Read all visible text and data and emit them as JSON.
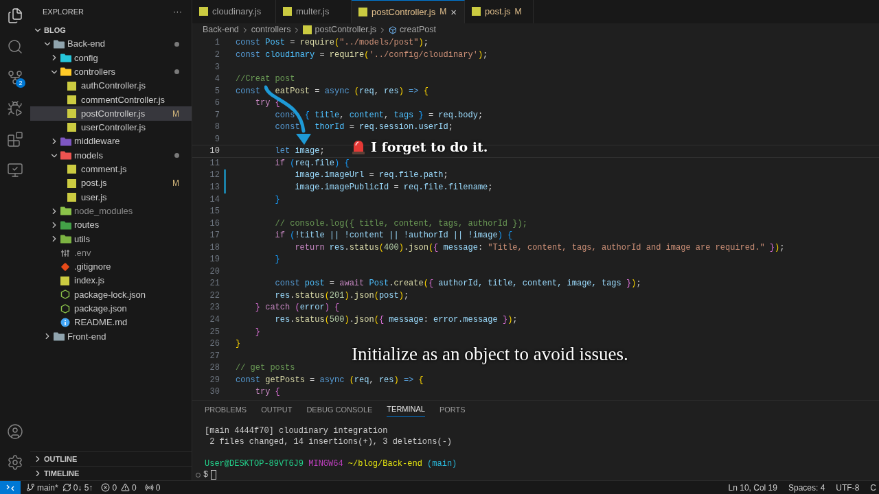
{
  "activity_bar": {
    "items": [
      {
        "kind": "explorer",
        "selected": true
      },
      {
        "kind": "search",
        "selected": false
      },
      {
        "kind": "source-control",
        "selected": false,
        "badge": "2"
      },
      {
        "kind": "run-debug",
        "selected": false
      },
      {
        "kind": "extensions",
        "selected": false
      },
      {
        "kind": "remote",
        "selected": false
      }
    ],
    "bottom": [
      {
        "kind": "account"
      },
      {
        "kind": "settings"
      }
    ]
  },
  "sidebar": {
    "title": "EXPLORER",
    "more": "···",
    "workspace": {
      "label": "BLOG",
      "expanded": true
    },
    "tree": [
      {
        "kind": "folder",
        "label": "Back-end",
        "color": "#90a4ae",
        "expanded": true,
        "dot": true,
        "selected": false,
        "dimmed": false,
        "children": [
          {
            "kind": "folder",
            "label": "config",
            "color": "#26c6da",
            "expanded": false,
            "dot": false,
            "selected": false,
            "dimmed": false
          },
          {
            "kind": "folder",
            "label": "controllers",
            "color": "#ffca28",
            "expanded": true,
            "dot": true,
            "selected": false,
            "dimmed": false,
            "children": [
              {
                "kind": "js",
                "label": "authController.js",
                "dot": false,
                "selected": false,
                "dimmed": false
              },
              {
                "kind": "js",
                "label": "commentController.js",
                "dot": false,
                "selected": false,
                "dimmed": false
              },
              {
                "kind": "js",
                "label": "postController.js",
                "badge": "M",
                "dot": false,
                "selected": true,
                "dimmed": false
              },
              {
                "kind": "js",
                "label": "userController.js",
                "dot": false,
                "selected": false,
                "dimmed": false
              }
            ]
          },
          {
            "kind": "folder",
            "label": "middleware",
            "color": "#7e57c2",
            "expanded": false,
            "dot": false,
            "selected": false,
            "dimmed": false
          },
          {
            "kind": "folder",
            "label": "models",
            "color": "#ef5350",
            "expanded": true,
            "dot": true,
            "selected": false,
            "dimmed": false,
            "children": [
              {
                "kind": "js",
                "label": "comment.js",
                "dot": false,
                "selected": false,
                "dimmed": false
              },
              {
                "kind": "js",
                "label": "post.js",
                "badge": "M",
                "dot": false,
                "selected": false,
                "dimmed": false
              },
              {
                "kind": "js",
                "label": "user.js",
                "dot": false,
                "selected": false,
                "dimmed": false
              }
            ]
          },
          {
            "kind": "folder",
            "label": "node_modules",
            "color": "#8bc34a",
            "expanded": false,
            "dot": false,
            "selected": false,
            "dimmed": true
          },
          {
            "kind": "folder",
            "label": "routes",
            "color": "#43a047",
            "expanded": false,
            "dot": false,
            "selected": false,
            "dimmed": false
          },
          {
            "kind": "folder",
            "label": "utils",
            "color": "#7cb342",
            "expanded": false,
            "dot": false,
            "selected": false,
            "dimmed": false
          },
          {
            "kind": "env",
            "label": ".env",
            "dot": false,
            "selected": false,
            "dimmed": true
          },
          {
            "kind": "git",
            "label": ".gitignore",
            "dot": false,
            "selected": false,
            "dimmed": false
          },
          {
            "kind": "js",
            "label": "index.js",
            "dot": false,
            "selected": false,
            "dimmed": false
          },
          {
            "kind": "npm",
            "label": "package-lock.json",
            "dot": false,
            "selected": false,
            "dimmed": false
          },
          {
            "kind": "npm",
            "label": "package.json",
            "dot": false,
            "selected": false,
            "dimmed": false
          },
          {
            "kind": "info",
            "label": "README.md",
            "dot": false,
            "selected": false,
            "dimmed": false
          }
        ]
      },
      {
        "kind": "folder",
        "label": "Front-end",
        "color": "#90a4ae",
        "expanded": false,
        "dot": false,
        "selected": false,
        "dimmed": false
      }
    ],
    "sections": [
      {
        "label": "OUTLINE",
        "expanded": false
      },
      {
        "label": "TIMELINE",
        "expanded": false
      }
    ]
  },
  "tabs": [
    {
      "label": "cloudinary.js",
      "selected": false
    },
    {
      "label": "multer.js",
      "selected": false
    },
    {
      "label": "postController.js",
      "badge": "M",
      "close": "×",
      "selected": true
    },
    {
      "label": "post.js",
      "badge": "M",
      "selected": false
    }
  ],
  "breadcrumb": [
    {
      "kind": "folder",
      "label": "Back-end"
    },
    {
      "kind": "folder",
      "label": "controllers"
    },
    {
      "kind": "file",
      "label": "postController.js"
    },
    {
      "kind": "symbol",
      "label": "creatPost"
    }
  ],
  "code": [
    {
      "num": "1",
      "current": false,
      "changed": false,
      "tokens": [
        {
          "text": "const ",
          "kind": "keyword"
        },
        {
          "text": "Post",
          "kind": "constant"
        },
        {
          "text": " = ",
          "kind": "punctuation"
        },
        {
          "text": "require",
          "kind": "function"
        },
        {
          "text": "(",
          "kind": "bracket1"
        },
        {
          "text": "\"../models/post\"",
          "kind": "string"
        },
        {
          "text": ")",
          "kind": "bracket1"
        },
        {
          "text": ";",
          "kind": "punctuation"
        }
      ]
    },
    {
      "num": "2",
      "current": false,
      "changed": false,
      "tokens": [
        {
          "text": "const ",
          "kind": "keyword"
        },
        {
          "text": "cloudinary",
          "kind": "constant"
        },
        {
          "text": " = ",
          "kind": "punctuation"
        },
        {
          "text": "require",
          "kind": "function"
        },
        {
          "text": "(",
          "kind": "bracket1"
        },
        {
          "text": "'../config/cloudinary'",
          "kind": "string"
        },
        {
          "text": ")",
          "kind": "bracket1"
        },
        {
          "text": ";",
          "kind": "punctuation"
        }
      ]
    },
    {
      "num": "3",
      "current": false,
      "changed": false
    },
    {
      "num": "4",
      "current": false,
      "changed": false,
      "tokens": [
        {
          "text": "//Creat post",
          "kind": "comment"
        }
      ]
    },
    {
      "num": "5",
      "current": false,
      "changed": false,
      "tokens": [
        {
          "text": "const",
          "kind": "keyword"
        },
        {
          "text": "   eatPost",
          "kind": "function"
        },
        {
          "text": " = ",
          "kind": "punctuation"
        },
        {
          "text": "async ",
          "kind": "keyword"
        },
        {
          "text": "(",
          "kind": "bracket1"
        },
        {
          "text": "req",
          "kind": "variable"
        },
        {
          "text": ", ",
          "kind": "punctuation"
        },
        {
          "text": "res",
          "kind": "variable"
        },
        {
          "text": ")",
          "kind": "bracket1"
        },
        {
          "text": " => ",
          "kind": "keyword"
        },
        {
          "text": "{",
          "kind": "bracket1"
        }
      ]
    },
    {
      "num": "6",
      "current": false,
      "changed": false,
      "tokens": [
        {
          "text": "    try ",
          "kind": "control"
        },
        {
          "text": "{",
          "kind": "bracket2"
        }
      ]
    },
    {
      "num": "7",
      "current": false,
      "changed": false,
      "tokens": [
        {
          "text": "        cons",
          "kind": "keyword"
        },
        {
          "text": "  { ",
          "kind": "bracket3"
        },
        {
          "text": "title",
          "kind": "constant"
        },
        {
          "text": ", ",
          "kind": "punctuation"
        },
        {
          "text": "content",
          "kind": "constant"
        },
        {
          "text": ", ",
          "kind": "punctuation"
        },
        {
          "text": "tags",
          "kind": "constant"
        },
        {
          "text": " }",
          "kind": "bracket3"
        },
        {
          "text": " = ",
          "kind": "punctuation"
        },
        {
          "text": "req.body",
          "kind": "variable"
        },
        {
          "text": ";",
          "kind": "punctuation"
        }
      ]
    },
    {
      "num": "8",
      "current": false,
      "changed": false,
      "tokens": [
        {
          "text": "        const",
          "kind": "keyword"
        },
        {
          "text": "   thorId",
          "kind": "constant"
        },
        {
          "text": " = ",
          "kind": "punctuation"
        },
        {
          "text": "req.session.userId",
          "kind": "variable"
        },
        {
          "text": ";",
          "kind": "punctuation"
        }
      ]
    },
    {
      "num": "9",
      "current": false,
      "changed": false
    },
    {
      "num": "10",
      "current": true,
      "changed": false,
      "tokens": [
        {
          "text": "        let ",
          "kind": "keyword"
        },
        {
          "text": "image",
          "kind": "variable"
        },
        {
          "text": ";",
          "kind": "punctuation"
        }
      ]
    },
    {
      "num": "11",
      "current": false,
      "changed": false,
      "tokens": [
        {
          "text": "        if ",
          "kind": "control"
        },
        {
          "text": "(",
          "kind": "bracket3"
        },
        {
          "text": "req.file",
          "kind": "variable"
        },
        {
          "text": ") ",
          "kind": "bracket3"
        },
        {
          "text": "{",
          "kind": "bracket3"
        }
      ]
    },
    {
      "num": "12",
      "current": false,
      "changed": true,
      "tokens": [
        {
          "text": "            image.imageUrl",
          "kind": "variable"
        },
        {
          "text": " = ",
          "kind": "punctuation"
        },
        {
          "text": "req.file.path",
          "kind": "variable"
        },
        {
          "text": ";",
          "kind": "punctuation"
        }
      ]
    },
    {
      "num": "13",
      "current": false,
      "changed": true,
      "tokens": [
        {
          "text": "            image.imagePublicId",
          "kind": "variable"
        },
        {
          "text": " = ",
          "kind": "punctuation"
        },
        {
          "text": "req.file.filename",
          "kind": "variable"
        },
        {
          "text": ";",
          "kind": "punctuation"
        }
      ]
    },
    {
      "num": "14",
      "current": false,
      "changed": false,
      "tokens": [
        {
          "text": "        }",
          "kind": "bracket3"
        }
      ]
    },
    {
      "num": "15",
      "current": false,
      "changed": false
    },
    {
      "num": "16",
      "current": false,
      "changed": false,
      "tokens": [
        {
          "text": "        // console.log({ title, content, tags, authorId });",
          "kind": "comment"
        }
      ]
    },
    {
      "num": "17",
      "current": false,
      "changed": false,
      "tokens": [
        {
          "text": "        if ",
          "kind": "control"
        },
        {
          "text": "(",
          "kind": "bracket3"
        },
        {
          "text": "!title || !content || !authorId || !image",
          "kind": "variable"
        },
        {
          "text": ") ",
          "kind": "bracket3"
        },
        {
          "text": "{",
          "kind": "bracket3"
        }
      ]
    },
    {
      "num": "18",
      "current": false,
      "changed": false,
      "tokens": [
        {
          "text": "            return ",
          "kind": "control"
        },
        {
          "text": "res",
          "kind": "variable"
        },
        {
          "text": ".",
          "kind": "punctuation"
        },
        {
          "text": "status",
          "kind": "function"
        },
        {
          "text": "(",
          "kind": "bracket1"
        },
        {
          "text": "400",
          "kind": "number"
        },
        {
          "text": ")",
          "kind": "bracket1"
        },
        {
          "text": ".",
          "kind": "punctuation"
        },
        {
          "text": "json",
          "kind": "function"
        },
        {
          "text": "(",
          "kind": "bracket1"
        },
        {
          "text": "{ ",
          "kind": "bracket2"
        },
        {
          "text": "message",
          "kind": "variable"
        },
        {
          "text": ": ",
          "kind": "punctuation"
        },
        {
          "text": "\"Title, content, tags, authorId and image are required.\"",
          "kind": "string"
        },
        {
          "text": " }",
          "kind": "bracket2"
        },
        {
          "text": ")",
          "kind": "bracket1"
        },
        {
          "text": ";",
          "kind": "punctuation"
        }
      ]
    },
    {
      "num": "19",
      "current": false,
      "changed": false,
      "tokens": [
        {
          "text": "        }",
          "kind": "bracket3"
        }
      ]
    },
    {
      "num": "20",
      "current": false,
      "changed": false
    },
    {
      "num": "21",
      "current": false,
      "changed": false,
      "tokens": [
        {
          "text": "        const ",
          "kind": "keyword"
        },
        {
          "text": "post",
          "kind": "constant"
        },
        {
          "text": " = ",
          "kind": "punctuation"
        },
        {
          "text": "await ",
          "kind": "control"
        },
        {
          "text": "Post",
          "kind": "constant"
        },
        {
          "text": ".",
          "kind": "punctuation"
        },
        {
          "text": "create",
          "kind": "function"
        },
        {
          "text": "(",
          "kind": "bracket1"
        },
        {
          "text": "{ ",
          "kind": "bracket2"
        },
        {
          "text": "authorId, title, content, image, tags",
          "kind": "variable"
        },
        {
          "text": " }",
          "kind": "bracket2"
        },
        {
          "text": ")",
          "kind": "bracket1"
        },
        {
          "text": ";",
          "kind": "punctuation"
        }
      ]
    },
    {
      "num": "22",
      "current": false,
      "changed": false,
      "tokens": [
        {
          "text": "        res",
          "kind": "variable"
        },
        {
          "text": ".",
          "kind": "punctuation"
        },
        {
          "text": "status",
          "kind": "function"
        },
        {
          "text": "(",
          "kind": "bracket1"
        },
        {
          "text": "201",
          "kind": "number"
        },
        {
          "text": ")",
          "kind": "bracket1"
        },
        {
          "text": ".",
          "kind": "punctuation"
        },
        {
          "text": "json",
          "kind": "function"
        },
        {
          "text": "(",
          "kind": "bracket1"
        },
        {
          "text": "post",
          "kind": "variable"
        },
        {
          "text": ")",
          "kind": "bracket1"
        },
        {
          "text": ";",
          "kind": "punctuation"
        }
      ]
    },
    {
      "num": "23",
      "current": false,
      "changed": false,
      "tokens": [
        {
          "text": "    }",
          "kind": "bracket2"
        },
        {
          "text": " catch ",
          "kind": "control"
        },
        {
          "text": "(",
          "kind": "bracket2"
        },
        {
          "text": "error",
          "kind": "variable"
        },
        {
          "text": ") ",
          "kind": "bracket2"
        },
        {
          "text": "{",
          "kind": "bracket2"
        }
      ]
    },
    {
      "num": "24",
      "current": false,
      "changed": false,
      "tokens": [
        {
          "text": "        res",
          "kind": "variable"
        },
        {
          "text": ".",
          "kind": "punctuation"
        },
        {
          "text": "status",
          "kind": "function"
        },
        {
          "text": "(",
          "kind": "bracket1"
        },
        {
          "text": "500",
          "kind": "number"
        },
        {
          "text": ")",
          "kind": "bracket1"
        },
        {
          "text": ".",
          "kind": "punctuation"
        },
        {
          "text": "json",
          "kind": "function"
        },
        {
          "text": "(",
          "kind": "bracket1"
        },
        {
          "text": "{ ",
          "kind": "bracket2"
        },
        {
          "text": "message",
          "kind": "variable"
        },
        {
          "text": ": ",
          "kind": "punctuation"
        },
        {
          "text": "error.message",
          "kind": "variable"
        },
        {
          "text": " }",
          "kind": "bracket2"
        },
        {
          "text": ")",
          "kind": "bracket1"
        },
        {
          "text": ";",
          "kind": "punctuation"
        }
      ]
    },
    {
      "num": "25",
      "current": false,
      "changed": false,
      "tokens": [
        {
          "text": "    }",
          "kind": "bracket2"
        }
      ]
    },
    {
      "num": "26",
      "current": false,
      "changed": false,
      "tokens": [
        {
          "text": "}",
          "kind": "bracket1"
        }
      ]
    },
    {
      "num": "27",
      "current": false,
      "changed": false
    },
    {
      "num": "28",
      "current": false,
      "changed": false,
      "tokens": [
        {
          "text": "// get posts",
          "kind": "comment"
        }
      ]
    },
    {
      "num": "29",
      "current": false,
      "changed": false,
      "tokens": [
        {
          "text": "const ",
          "kind": "keyword"
        },
        {
          "text": "getPosts",
          "kind": "function"
        },
        {
          "text": " = ",
          "kind": "punctuation"
        },
        {
          "text": "async ",
          "kind": "keyword"
        },
        {
          "text": "(",
          "kind": "bracket1"
        },
        {
          "text": "req",
          "kind": "variable"
        },
        {
          "text": ", ",
          "kind": "punctuation"
        },
        {
          "text": "res",
          "kind": "variable"
        },
        {
          "text": ")",
          "kind": "bracket1"
        },
        {
          "text": " => ",
          "kind": "keyword"
        },
        {
          "text": "{",
          "kind": "bracket1"
        }
      ]
    },
    {
      "num": "30",
      "current": false,
      "changed": false,
      "tokens": [
        {
          "text": "    try ",
          "kind": "control"
        },
        {
          "text": "{",
          "kind": "bracket2"
        }
      ]
    }
  ],
  "annotations": {
    "callout": "I forget to do it.",
    "caption": "Initialize as an object to avoid issues."
  },
  "panel": {
    "tabs": [
      {
        "label": "PROBLEMS",
        "selected": false
      },
      {
        "label": "OUTPUT",
        "selected": false
      },
      {
        "label": "DEBUG CONSOLE",
        "selected": false
      },
      {
        "label": "TERMINAL",
        "selected": true
      },
      {
        "label": "PORTS",
        "selected": false
      }
    ],
    "output": [
      "[main 4444f70] cloudinary integration",
      " 2 files changed, 14 insertions(+), 3 deletions(-)"
    ],
    "prompt": [
      {
        "text": "User@DESKTOP-89VT6J9",
        "kind": "user"
      },
      {
        "text": "MINGW64",
        "kind": "system"
      },
      {
        "text": "~/blog/Back-end",
        "kind": "path"
      },
      {
        "text": "(main)",
        "kind": "branch"
      }
    ],
    "input_symbol": "$"
  },
  "status_bar": {
    "branch": "main*",
    "sync": "0↓ 5↑",
    "errors": "0",
    "warnings": "0",
    "ports": "0",
    "right": [
      "Ln 10, Col 19",
      "Spaces: 4",
      "UTF-8",
      "C"
    ]
  }
}
